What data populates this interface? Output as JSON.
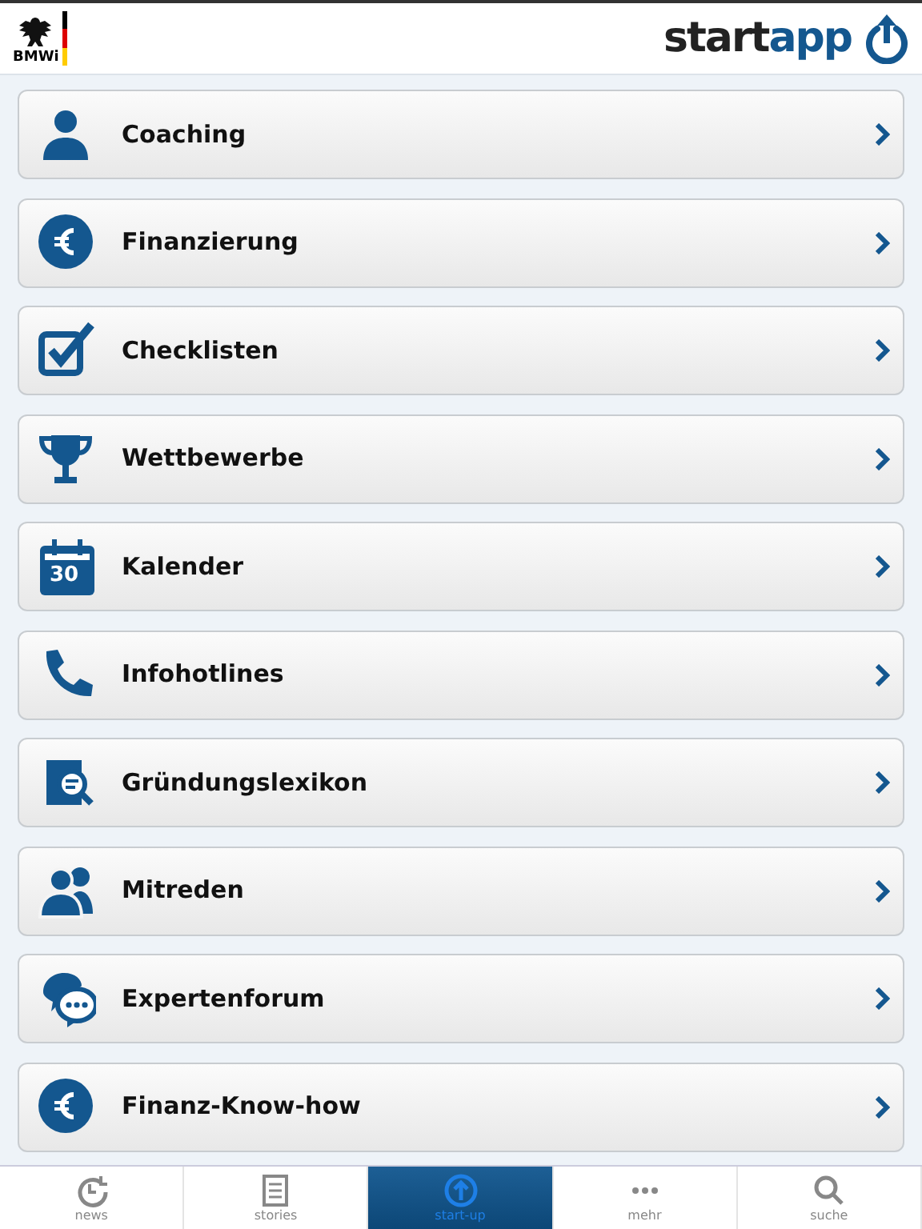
{
  "header": {
    "ministry_logo": "BMWi",
    "app_logo_dark": "start",
    "app_logo_blue": "app"
  },
  "menu": [
    {
      "kind": "person",
      "label": "Coaching"
    },
    {
      "kind": "euro",
      "label": "Finanzierung"
    },
    {
      "kind": "checkbox",
      "label": "Checklisten"
    },
    {
      "kind": "trophy",
      "label": "Wettbewerbe"
    },
    {
      "kind": "calendar",
      "icon_text": "30",
      "label": "Kalender"
    },
    {
      "kind": "phone",
      "label": "Infohotlines"
    },
    {
      "kind": "lexicon",
      "label": "Gründungslexikon"
    },
    {
      "kind": "people",
      "label": "Mitreden"
    },
    {
      "kind": "chat",
      "label": "Expertenforum"
    },
    {
      "kind": "euro",
      "label": "Finanz-Know-how"
    }
  ],
  "tab_bar": [
    {
      "kind": "clock",
      "label": "news",
      "selected": false
    },
    {
      "kind": "document",
      "label": "stories",
      "selected": false
    },
    {
      "kind": "upload",
      "label": "start-up",
      "selected": true
    },
    {
      "kind": "dots",
      "label": "mehr",
      "selected": false
    },
    {
      "kind": "search",
      "label": "suche",
      "selected": false
    }
  ]
}
